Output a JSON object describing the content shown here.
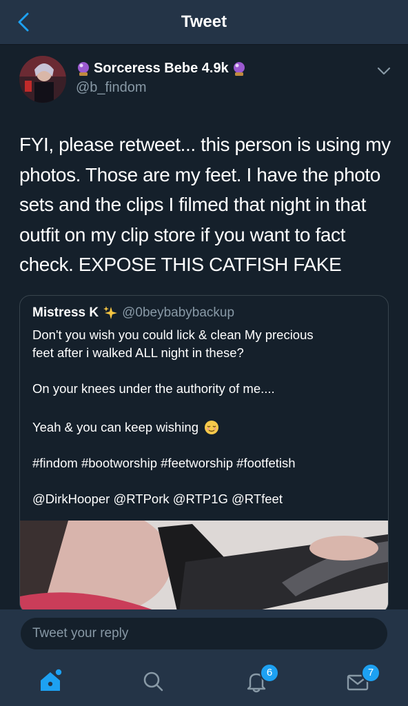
{
  "header": {
    "title": "Tweet"
  },
  "tweet": {
    "author_name": "Sorceress Bebe 4.9k",
    "author_handle": "@b_findom",
    "text_lines": [
      "FYI, please retweet... this person is using my",
      "photos. Those are my feet. I have the photo",
      "sets and the clips I filmed that night in that",
      "outfit on my clip store if you want to fact",
      "check. EXPOSE THIS CATFISH FAKE"
    ]
  },
  "quoted_tweet": {
    "author_name": "Mistress K",
    "author_handle": "@0beybabybackup",
    "lines": [
      "Don't you wish you could lick & clean My precious",
      "feet after i walked ALL night in these?",
      "On your knees under the authority of me....",
      "Yeah & you can keep wishing",
      "#findom #bootworship #feetworship #footfetish",
      "@DirkHooper @RTPork @RTP1G @RTfeet"
    ]
  },
  "reply": {
    "placeholder": "Tweet your reply"
  },
  "nav": {
    "notifications_count": "6",
    "messages_count": "7"
  },
  "colors": {
    "background": "#15202b",
    "bar": "#243447",
    "accent": "#1da1f2",
    "secondary_text": "#8899a6"
  },
  "icons": [
    "back-arrow-icon",
    "crystal-ball-icon",
    "chevron-down-icon",
    "sparkles-icon",
    "relieved-face-emoji",
    "home-icon",
    "search-icon",
    "bell-icon",
    "mail-icon"
  ]
}
